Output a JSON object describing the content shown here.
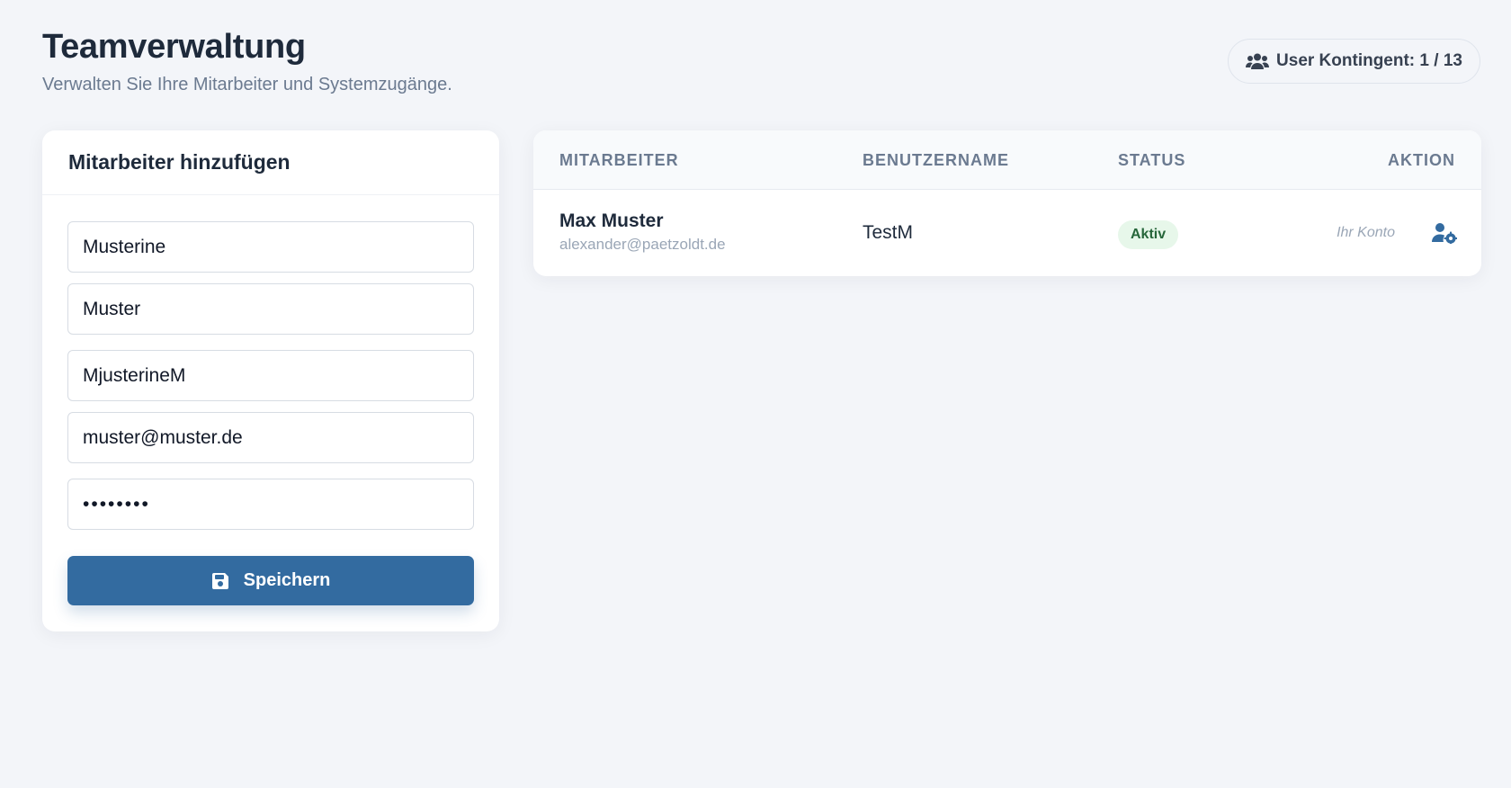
{
  "header": {
    "title": "Teamverwaltung",
    "subtitle": "Verwalten Sie Ihre Mitarbeiter und Systemzugänge.",
    "quota_label": "User Kontingent: 1 / 13",
    "quota_icon": "users-icon"
  },
  "form": {
    "title": "Mitarbeiter hinzufügen",
    "fields": [
      {
        "value": "Musterine"
      },
      {
        "value": "Muster"
      },
      {
        "value": "MjusterineM"
      },
      {
        "value": "muster@muster.de"
      },
      {
        "value": "••••••••"
      }
    ],
    "save_label": "Speichern",
    "save_icon": "floppy-disk-icon"
  },
  "table": {
    "columns": [
      "MITARBEITER",
      "BENUTZERNAME",
      "STATUS",
      "AKTION"
    ],
    "rows": [
      {
        "name": "Max Muster",
        "email": "alexander@paetzoldt.de",
        "username": "TestM",
        "status": "Aktiv",
        "action_note": "Ihr Konto",
        "action_icon": "user-cog-icon"
      }
    ]
  },
  "colors": {
    "primary": "#336ba0",
    "background": "#f3f5f9",
    "status_active_bg": "#e7f7ea",
    "status_active_text": "#26663a"
  }
}
